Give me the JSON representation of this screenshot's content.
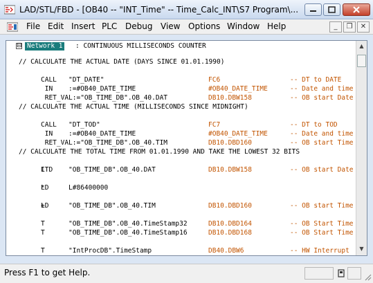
{
  "window": {
    "title": "LAD/STL/FBD  - [OB40 -- \"INT_Time\" -- Time_Calc_INT\\S7 Program\\..."
  },
  "menu": {
    "items": [
      "File",
      "Edit",
      "Insert",
      "PLC",
      "Debug",
      "View",
      "Options",
      "Window",
      "Help"
    ]
  },
  "network": {
    "toggle": "⊟",
    "label": "Network 1",
    "title": ": CONTINUOUS MILLISECONDS COUNTER"
  },
  "code": {
    "l01": {
      "c0": "// CALCULATE THE ACTUAL DATE (DAYS SINCE 01.01.1990)"
    },
    "l02": {
      "c1": "CALL",
      "c2": "\"DT_DATE\"",
      "c3": "FC6",
      "c4": "-- DT to DATE"
    },
    "l03": {
      "c1": " IN",
      "c2": ":=#OB40_DATE_TIME",
      "c3": "#OB40_DATE_TIME",
      "c4": "-- Date and time"
    },
    "l04": {
      "c1": " RET_VAL:=\"OB_TIME_DB\".OB_40.DAT",
      "c3": "DB10.DBW158",
      "c4": "-- OB start Date"
    },
    "l05": {
      "c0": "// CALCULATE THE ACTUAL TIME (MILLISECONDS SINCE MIDNIGHT)"
    },
    "l06": {
      "c1": "CALL",
      "c2": "\"DT_TOD\"",
      "c3": "FC7",
      "c4": "-- DT to TOD"
    },
    "l07": {
      "c1": " IN",
      "c2": ":=#OB40_DATE_TIME",
      "c3": "#OB40_DATE_TIME",
      "c4": "-- Date and time"
    },
    "l08": {
      "c1": " RET_VAL:=\"OB_TIME_DB\".OB_40.TIM",
      "c3": "DB10.DBD160",
      "c4": "-- OB start Time"
    },
    "l09": {
      "c0": "// CALCULATE THE TOTAL TIME FROM 01.01.1990 AND TAKE THE LOWEST 32 BITS"
    },
    "l10": {
      "c1": "L",
      "c2": "\"OB_TIME_DB\".OB_40.DAT",
      "c3": "DB10.DBW158",
      "c4": "-- OB start Date"
    },
    "l11": {
      "c1": "ITD"
    },
    "l12": {
      "c1": "L",
      "c2": "L#86400000"
    },
    "l13": {
      "c1": "*D"
    },
    "l14": {
      "c1": "L",
      "c2": "\"OB_TIME_DB\".OB_40.TIM",
      "c3": "DB10.DBD160",
      "c4": "-- OB start Time"
    },
    "l15": {
      "c1": "+D"
    },
    "l16": {
      "c1": "T",
      "c2": "\"OB_TIME_DB\".OB_40.TimeStamp32",
      "c3": "DB10.DBD164",
      "c4": "-- OB Start Time"
    },
    "l17": {
      "c1": "T",
      "c2": "\"OB_TIME_DB\".OB_40.TimeStamp16",
      "c3": "DB10.DBD168",
      "c4": "-- OB Start Time"
    },
    "l18": {
      "c1": "T",
      "c2": "\"IntProcDB\".TimeStamp",
      "c3": "DB40.DBW6",
      "c4": "-- HW Interrupt"
    }
  },
  "status": {
    "help_text": "Press F1 to get Help."
  },
  "colors": {
    "keyword_orange": "#c25400",
    "network_label_bg": "#1a7c7c"
  }
}
